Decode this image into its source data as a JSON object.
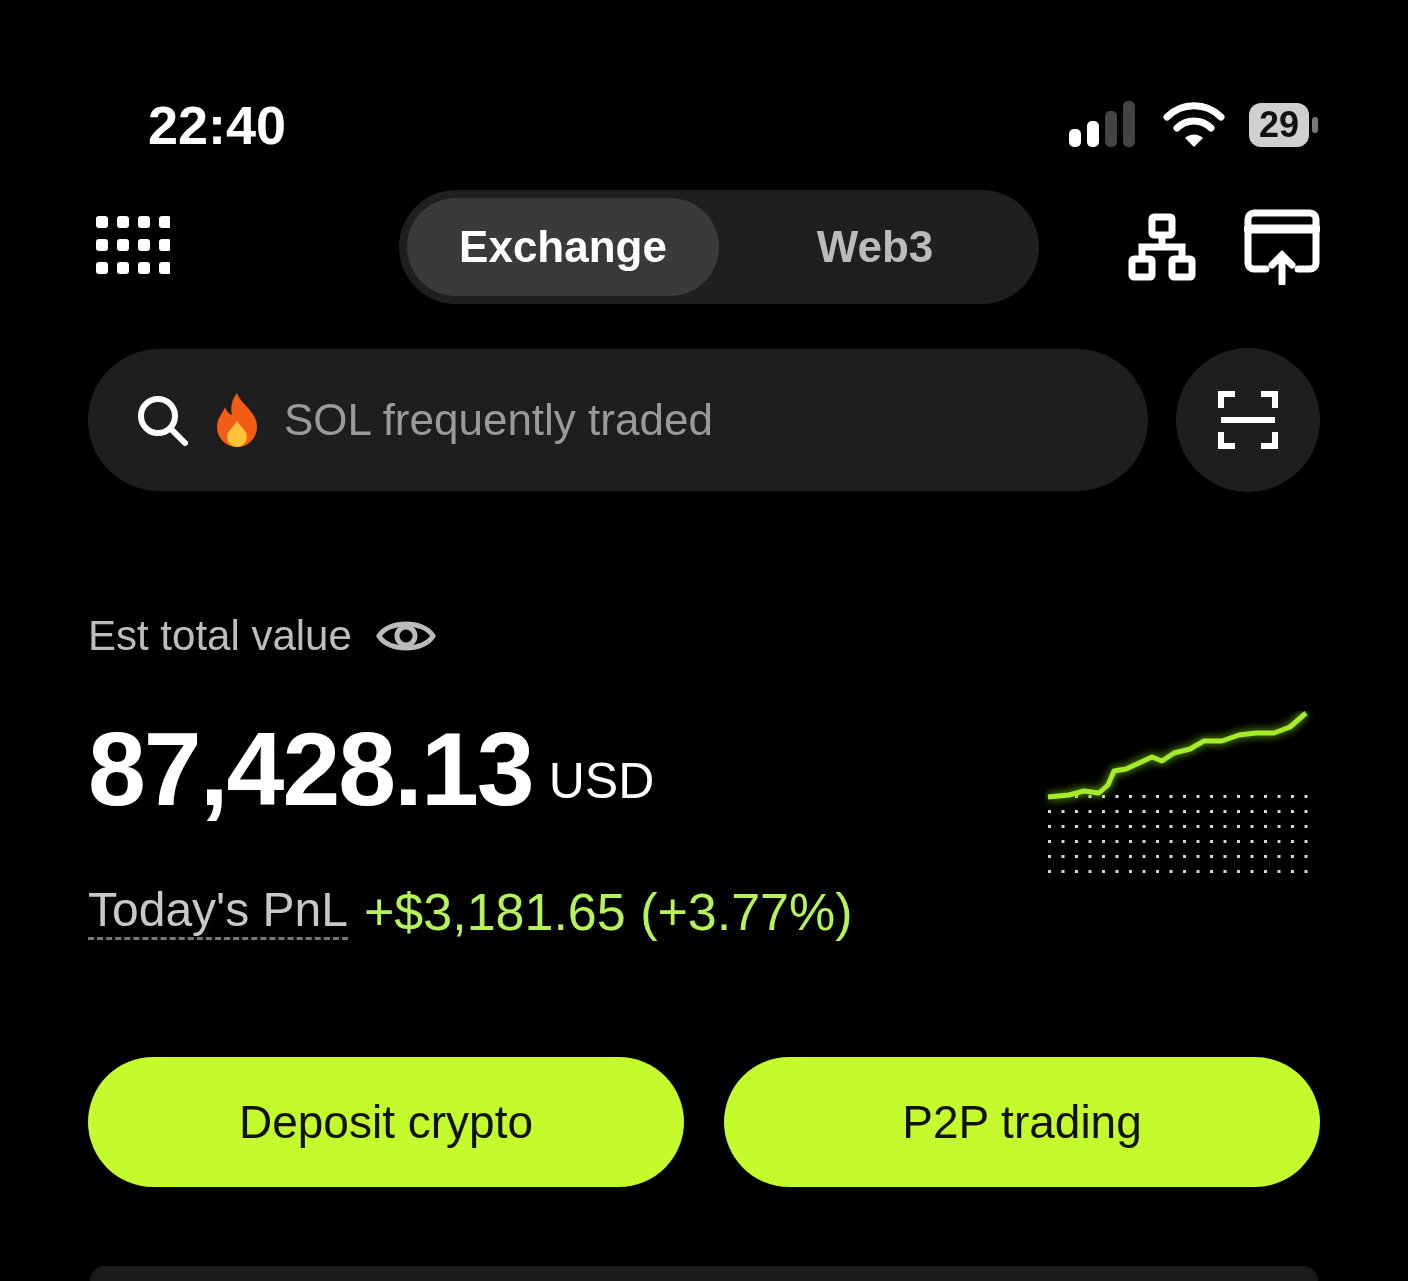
{
  "status_bar": {
    "time": "22:40",
    "battery": "29"
  },
  "tabs": [
    {
      "label": "Exchange",
      "selected": true
    },
    {
      "label": "Web3",
      "selected": false
    }
  ],
  "search": {
    "placeholder": "SOL frequently traded"
  },
  "balance": {
    "label": "Est total value",
    "value": "87,428.13",
    "currency": "USD",
    "pnl_label": "Today's PnL",
    "pnl_value": "+$3,181.65 (+3.77%)"
  },
  "buttons": [
    {
      "label": "Deposit crypto"
    },
    {
      "label": "P2P trading"
    }
  ]
}
